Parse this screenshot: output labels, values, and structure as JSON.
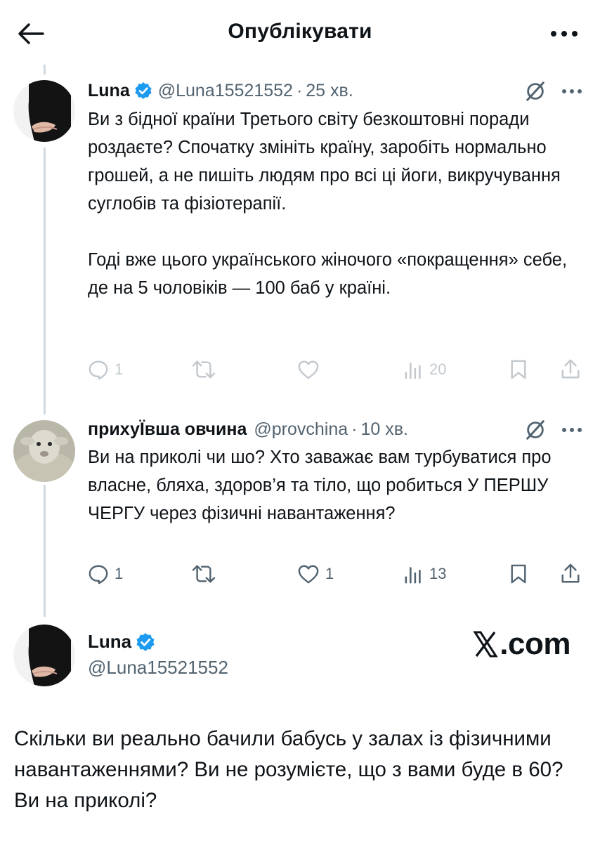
{
  "header": {
    "title": "Опублікувати"
  },
  "colors": {
    "verified_badge": "#1d9bf0",
    "icon_gray": "#536471",
    "thread_line": "#cfd9de",
    "text": "#0f1419"
  },
  "tweets": [
    {
      "name": "Luna",
      "handle": "@Luna15521552",
      "separator": "·",
      "time": "25 хв.",
      "verified": true,
      "avatar_icon": "avatar-dark-person",
      "text_paragraphs": [
        "Ви з бідної країни Третього світу безкоштовні поради роздаєте? Спочатку змініть країну, заробіть нормально грошей, а не пишіть людям про всі ці йоги, викручування суглобів та фізіотерапії.",
        "Годі вже цього українського жіночого «покращення» себе, де на 5 чоловіків — 100 баб у країні."
      ],
      "replies": "1",
      "retweets": "",
      "likes": "",
      "views": "20"
    },
    {
      "name": "прихуЇвша овчина",
      "handle": "@provchina",
      "separator": "·",
      "time": "10 хв.",
      "verified": false,
      "avatar_icon": "avatar-sheep",
      "text_paragraphs": [
        "Ви на приколі чи шо? Хто заважає вам турбуватися про власне, бляха, здоров’я та тіло, що робиться У ПЕРШУ ЧЕРГУ через фізичні навантаження?"
      ],
      "replies": "1",
      "retweets": "",
      "likes": "1",
      "views": "13"
    }
  ],
  "quoted": {
    "name": "Luna",
    "handle": "@Luna15521552",
    "verified": true,
    "watermark": ".com",
    "text": "Скільки ви реально бачили бабусь у залах із фізичними навантаженнями? Ви не розумієте, що з вами буде в 60? Ви на приколі?"
  },
  "icons": [
    "back-arrow-icon",
    "more-icon",
    "verified-badge-icon",
    "grok-icon",
    "reply-icon",
    "retweet-icon",
    "like-icon",
    "views-icon",
    "bookmark-icon",
    "share-icon"
  ]
}
